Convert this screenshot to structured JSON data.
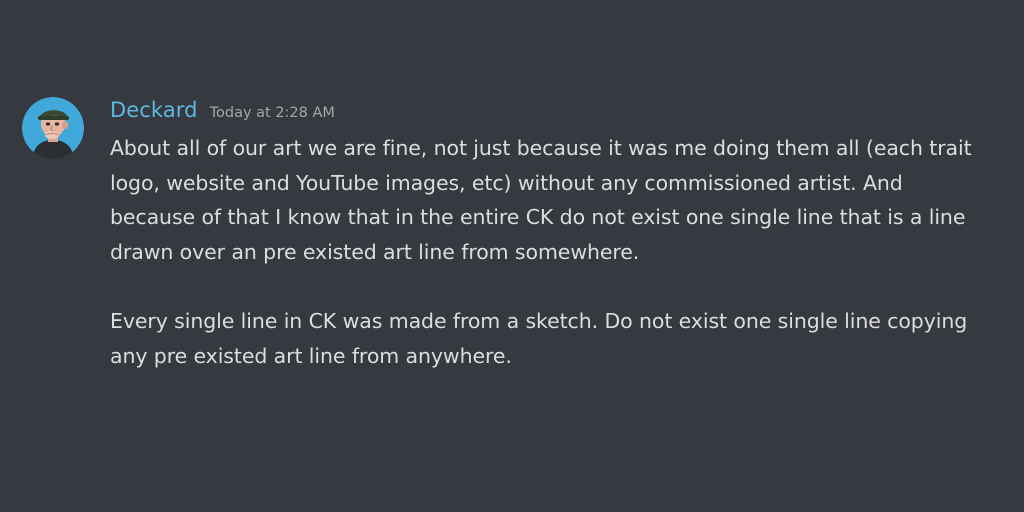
{
  "message": {
    "author": "Deckard",
    "timestamp": "Today at 2:28 AM",
    "avatar_icon": "user-avatar-cartoon-character",
    "colors": {
      "background": "#36393f",
      "username": "#5bb9e3",
      "text": "#dcddde",
      "timestamp": "#a3a6aa",
      "avatar_bg": "#41a9d9"
    },
    "paragraphs": [
      {
        "lines": [
          "About all of our art we are fine, not just because it was me doing them all (each trait",
          "logo, website and YouTube images, etc) without any commissioned artist. And",
          "because of that I know that in the entire CK do not exist one single line that is a line",
          "drawn over an pre existed art line from somewhere."
        ]
      },
      {
        "lines": [
          "Every single line in CK was made from a sketch. Do not exist one single line copying",
          "any pre existed art line from anywhere."
        ]
      }
    ]
  }
}
